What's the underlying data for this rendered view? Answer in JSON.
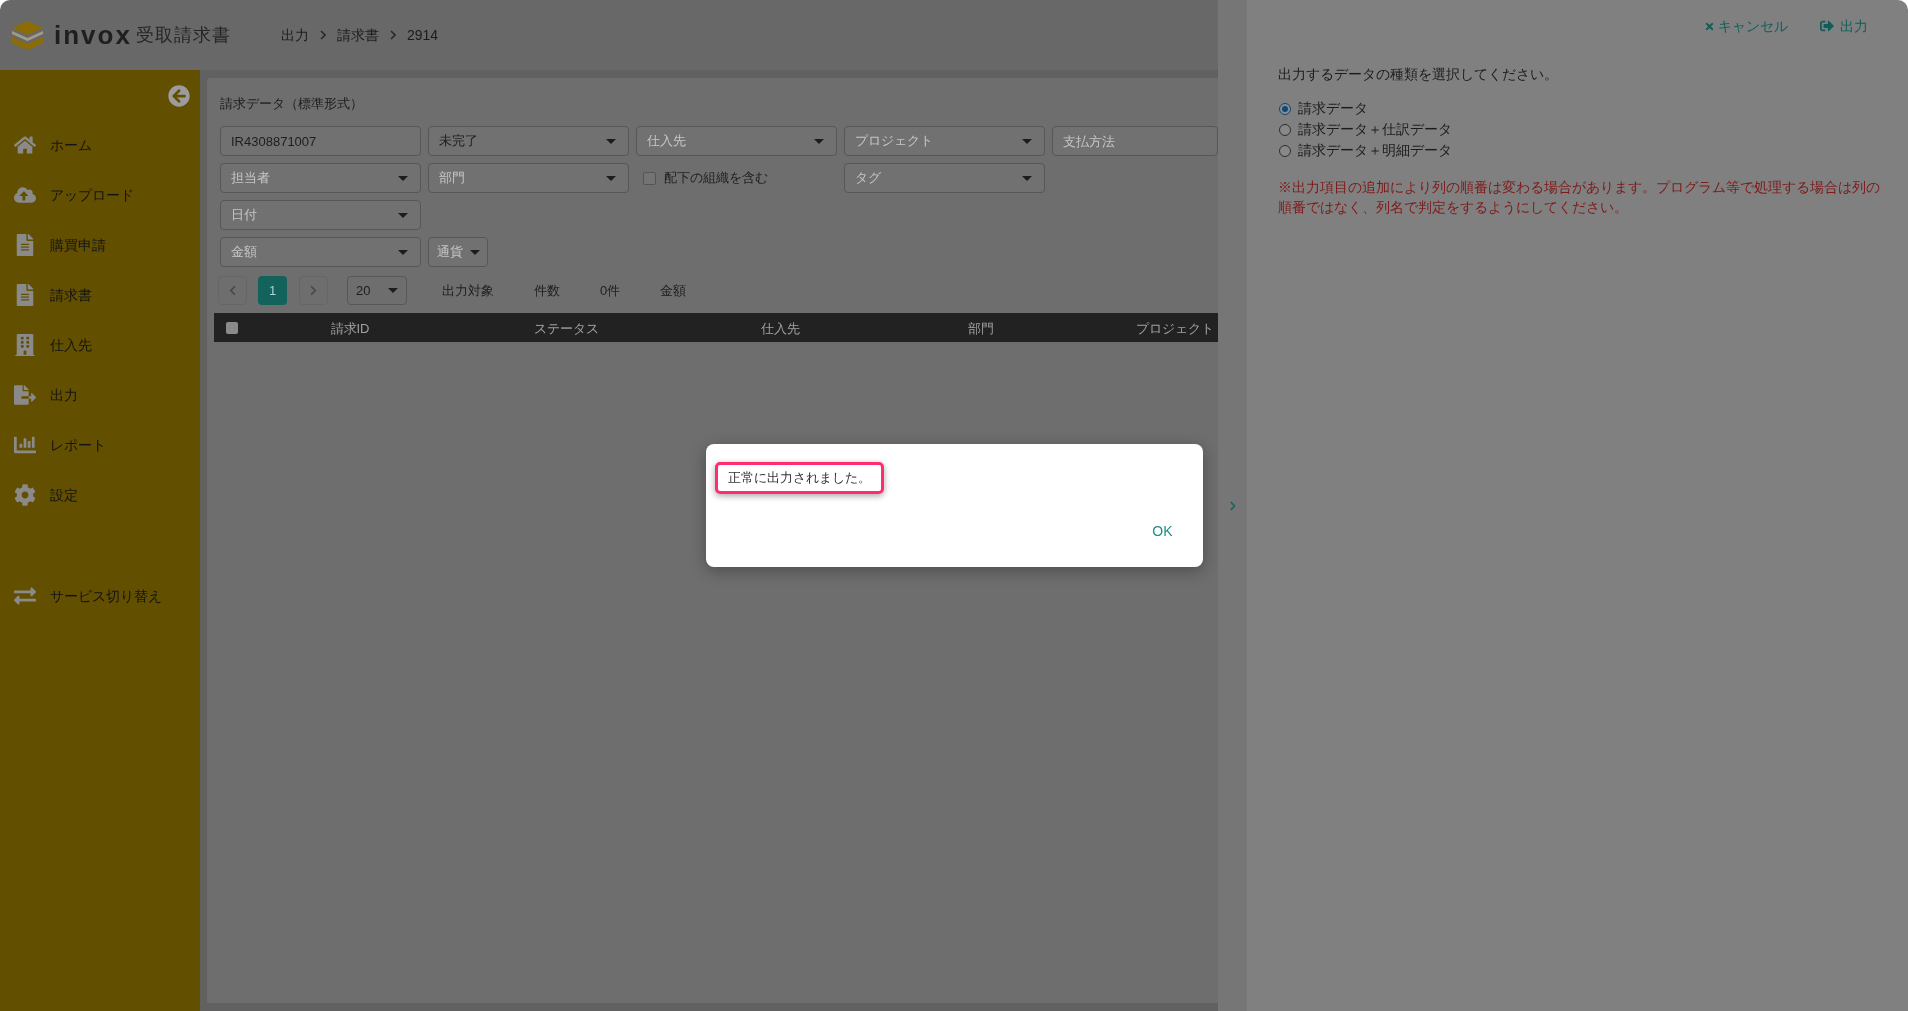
{
  "header": {
    "logo_text": "invox",
    "product_name": "受取請求書",
    "breadcrumb": [
      "出力",
      "請求書",
      "2914"
    ]
  },
  "sidebar": {
    "items": [
      "ホーム",
      "アップロード",
      "購買申請",
      "請求書",
      "仕入先",
      "出力",
      "レポート",
      "設定"
    ],
    "switch_item": "サービス切り替え"
  },
  "main": {
    "title": "請求データ（標準形式）",
    "filter_rows": [
      [
        {
          "kind": "input",
          "value": "IR4308871007"
        },
        {
          "kind": "select",
          "value": "未完了"
        },
        {
          "kind": "select",
          "placeholder": "仕入先"
        },
        {
          "kind": "select",
          "placeholder": "プロジェクト"
        },
        {
          "kind": "input",
          "placeholder": "支払方法"
        }
      ],
      [
        {
          "kind": "select",
          "placeholder": "担当者"
        },
        {
          "kind": "select",
          "placeholder": "部門"
        },
        {
          "kind": "checkbox",
          "label": "配下の組織を含む",
          "checked": false
        },
        {
          "kind": "select",
          "placeholder": "タグ"
        }
      ],
      [
        {
          "kind": "select",
          "placeholder": "日付"
        }
      ],
      [
        {
          "kind": "select",
          "placeholder": "金額"
        },
        {
          "kind": "compact_select",
          "placeholder": "通貨"
        }
      ]
    ],
    "pagination": {
      "pages": [
        {
          "label": "1",
          "selected": true
        }
      ],
      "page_size": "20"
    },
    "summary": [
      "出力対象",
      "件数",
      "0件",
      "金額"
    ],
    "table": {
      "select_all_checked": false,
      "columns": [
        "請求ID",
        "ステータス",
        "仕入先",
        "部門",
        "プロジェクト"
      ]
    }
  },
  "export_panel": {
    "actions": [
      {
        "kind": "cancel",
        "label": "キャンセル"
      },
      {
        "kind": "export",
        "label": "出力"
      }
    ],
    "prompt": "出力するデータの種類を選択してください。",
    "options": [
      {
        "label": "請求データ",
        "selected": true
      },
      {
        "label": "請求データ＋仕訳データ",
        "selected": false
      },
      {
        "label": "請求データ＋明細データ",
        "selected": false
      }
    ],
    "note": "※出力項目の追加により列の順番は変わる場合があります。プログラム等で処理する場合は列の順番ではなく、列名で判定をするようにしてください。"
  },
  "dialog": {
    "message": "正常に出力されました。",
    "highlighted": true,
    "button": "OK"
  }
}
